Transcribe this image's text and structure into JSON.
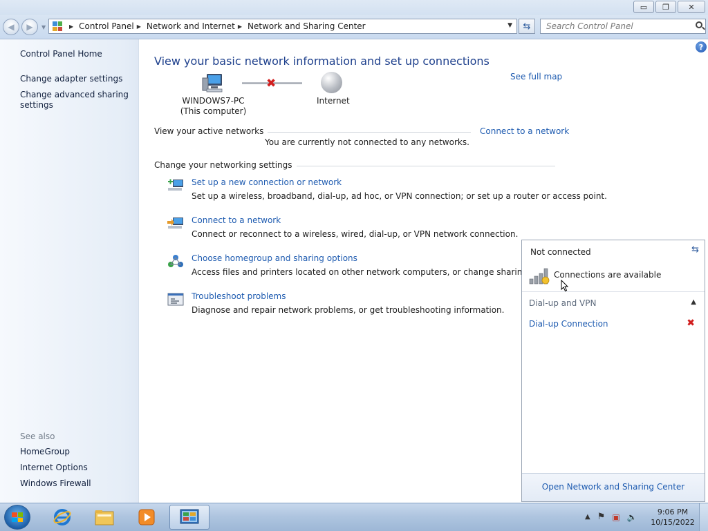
{
  "window": {
    "minimize_glyph": "▭",
    "restore_glyph": "❐",
    "close_glyph": "✕"
  },
  "address": {
    "breadcrumbs": [
      "Control Panel",
      "Network and Internet",
      "Network and Sharing Center"
    ],
    "search_placeholder": "Search Control Panel"
  },
  "sidebar": {
    "home": "Control Panel Home",
    "items": [
      "Change adapter settings",
      "Change advanced sharing settings"
    ],
    "see_also_heading": "See also",
    "see_also": [
      "HomeGroup",
      "Internet Options",
      "Windows Firewall"
    ]
  },
  "main": {
    "title": "View your basic network information and set up connections",
    "see_full_map": "See full map",
    "computer_name": "WINDOWS7-PC",
    "computer_sub": "(This computer)",
    "internet_label": "Internet",
    "active_networks_label": "View your active networks",
    "connect_link": "Connect to a network",
    "not_connected_msg": "You are currently not connected to any networks.",
    "change_settings_label": "Change your networking settings",
    "tasks": [
      {
        "link": "Set up a new connection or network",
        "desc": "Set up a wireless, broadband, dial-up, ad hoc, or VPN connection; or set up a router or access point.",
        "icon": "new-connection-icon"
      },
      {
        "link": "Connect to a network",
        "desc": "Connect or reconnect to a wireless, wired, dial-up, or VPN network connection.",
        "icon": "connect-network-icon"
      },
      {
        "link": "Choose homegroup and sharing options",
        "desc": "Access files and printers located on other network computers, or change sharing settings.",
        "icon": "homegroup-icon"
      },
      {
        "link": "Troubleshoot problems",
        "desc": "Diagnose and repair network problems, or get troubleshooting information.",
        "icon": "troubleshoot-icon"
      }
    ]
  },
  "flyout": {
    "status": "Not connected",
    "available": "Connections are available",
    "group": "Dial-up and VPN",
    "connection": "Dial-up Connection",
    "open_center": "Open Network and Sharing Center"
  },
  "taskbar": {
    "time": "9:06 PM",
    "date": "10/15/2022",
    "pinned": [
      "internet-explorer-icon",
      "windows-explorer-icon",
      "media-player-icon",
      "control-panel-icon"
    ]
  },
  "colors": {
    "link": "#1e5bb0",
    "title": "#1d3f8c",
    "error_x": "#d11e1e"
  }
}
